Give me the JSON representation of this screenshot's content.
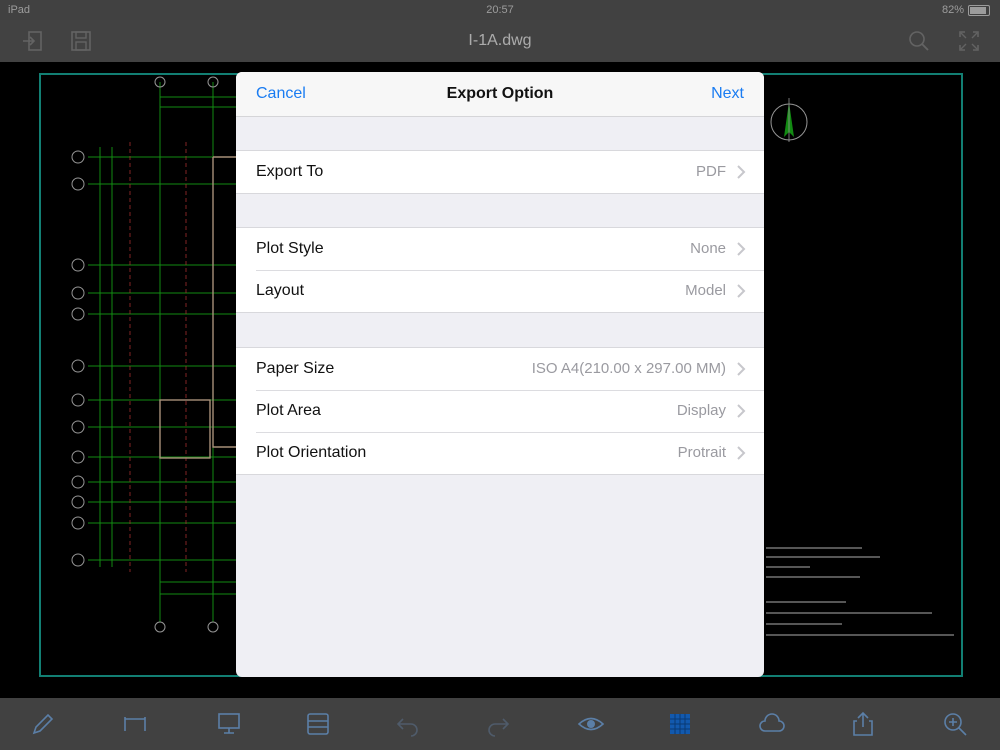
{
  "status_bar": {
    "device": "iPad",
    "time": "20:57",
    "battery": "82%"
  },
  "nav": {
    "title": "I-1A.dwg",
    "icons": [
      "exit-icon",
      "save-icon",
      "search-icon",
      "fullscreen-icon"
    ]
  },
  "modal": {
    "cancel_label": "Cancel",
    "title": "Export Option",
    "next_label": "Next",
    "groups": [
      [
        {
          "label": "Export To",
          "value": "PDF"
        }
      ],
      [
        {
          "label": "Plot Style",
          "value": "None"
        },
        {
          "label": "Layout",
          "value": "Model"
        }
      ],
      [
        {
          "label": "Paper Size",
          "value": "ISO A4(210.00 x 297.00 MM)"
        },
        {
          "label": "Plot Area",
          "value": "Display"
        },
        {
          "label": "Plot Orientation",
          "value": "Protrait"
        }
      ]
    ]
  },
  "toolbar": {
    "icons": [
      "pencil-icon",
      "measure-icon",
      "screen-icon",
      "layers-icon",
      "undo-icon",
      "redo-icon",
      "eye-icon",
      "grid-icon",
      "cloud-icon",
      "share-icon",
      "zoom-icon"
    ]
  },
  "colors": {
    "accent": "#1a7cf2",
    "bar": "#5a5a5a",
    "drawing_green": "#19c019",
    "drawing_cyan": "#1ab0a0"
  }
}
